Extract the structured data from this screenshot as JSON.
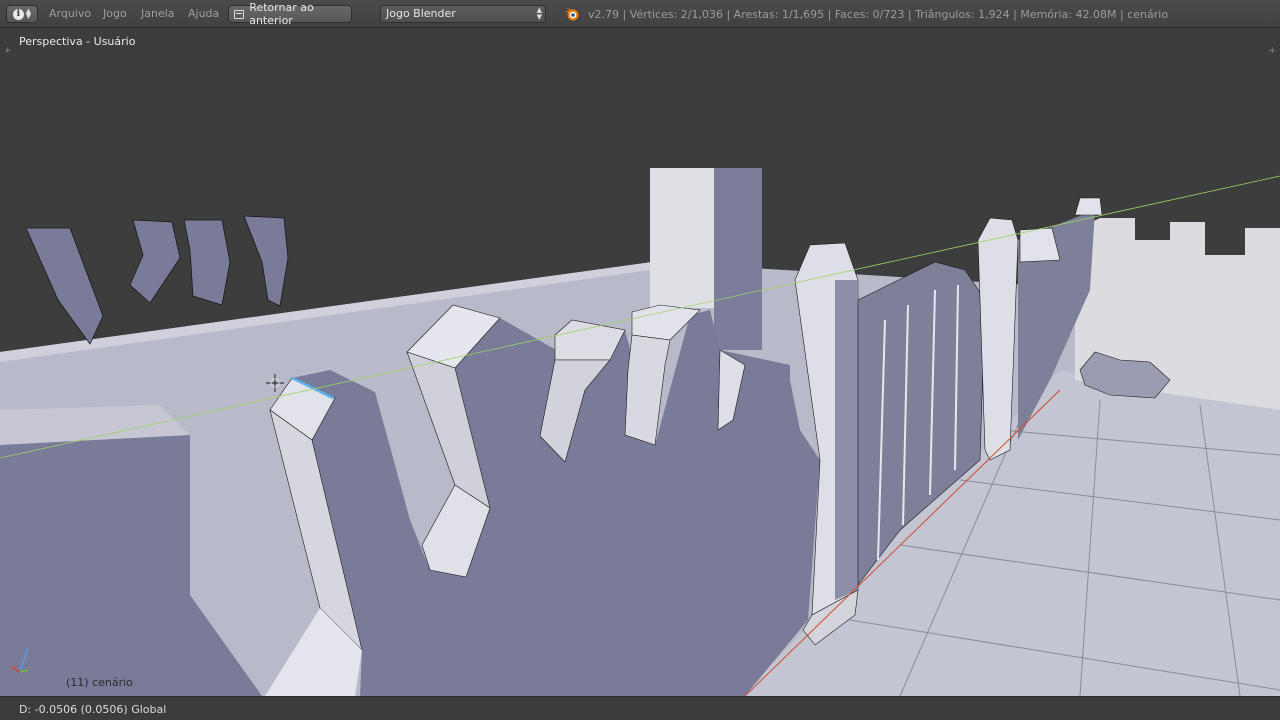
{
  "header": {
    "editor_icon": "info-icon",
    "menus": [
      "Arquivo",
      "Jogo",
      "Janela",
      "Ajuda"
    ],
    "back_button": "Retornar ao anterior",
    "render_engine": "Jogo Blender",
    "stats": "v2.79 | Vértices: 2/1,036 | Arestas: 1/1,695 | Faces: 0/723 | Triângulos: 1,924 | Memória: 42.08M | cenário"
  },
  "viewport": {
    "view_name": "Perspectiva - Usuário",
    "object_info": "(11) cenário"
  },
  "status": {
    "text": "D: -0.0506 (0.0506) Global"
  },
  "colors": {
    "background": "#3d3d3d",
    "wall_face": "#797b99",
    "light_face": "#d4d4dc",
    "floor": "#b7b8c8",
    "selection": "#5ab4f0",
    "axis_line": "#9bd36a"
  }
}
